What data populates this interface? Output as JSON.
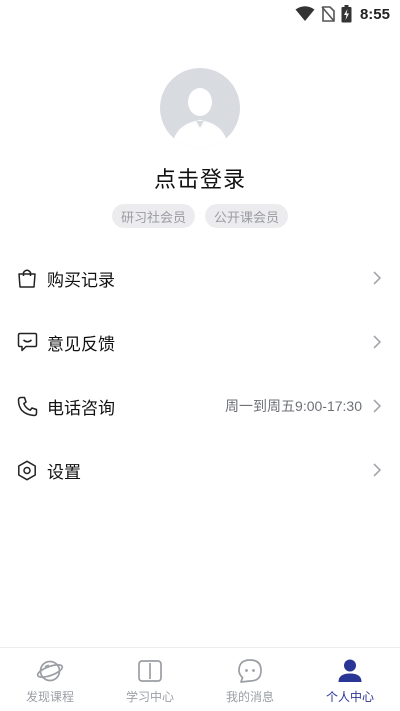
{
  "status_bar": {
    "time": "8:55"
  },
  "profile": {
    "login_text": "点击登录",
    "badges": [
      "研习社会员",
      "公开课会员"
    ]
  },
  "menu": {
    "items": [
      {
        "label": "购买记录",
        "value": ""
      },
      {
        "label": "意见反馈",
        "value": ""
      },
      {
        "label": "电话咨询",
        "value": "周一到周五9:00-17:30"
      },
      {
        "label": "设置",
        "value": ""
      }
    ]
  },
  "tabbar": {
    "tabs": [
      {
        "label": "发现课程"
      },
      {
        "label": "学习中心"
      },
      {
        "label": "我的消息"
      },
      {
        "label": "个人中心"
      }
    ],
    "active_index": 3
  },
  "colors": {
    "accent": "#2b3595",
    "inactive": "#9b9ea4",
    "badge_bg": "#ececee"
  }
}
